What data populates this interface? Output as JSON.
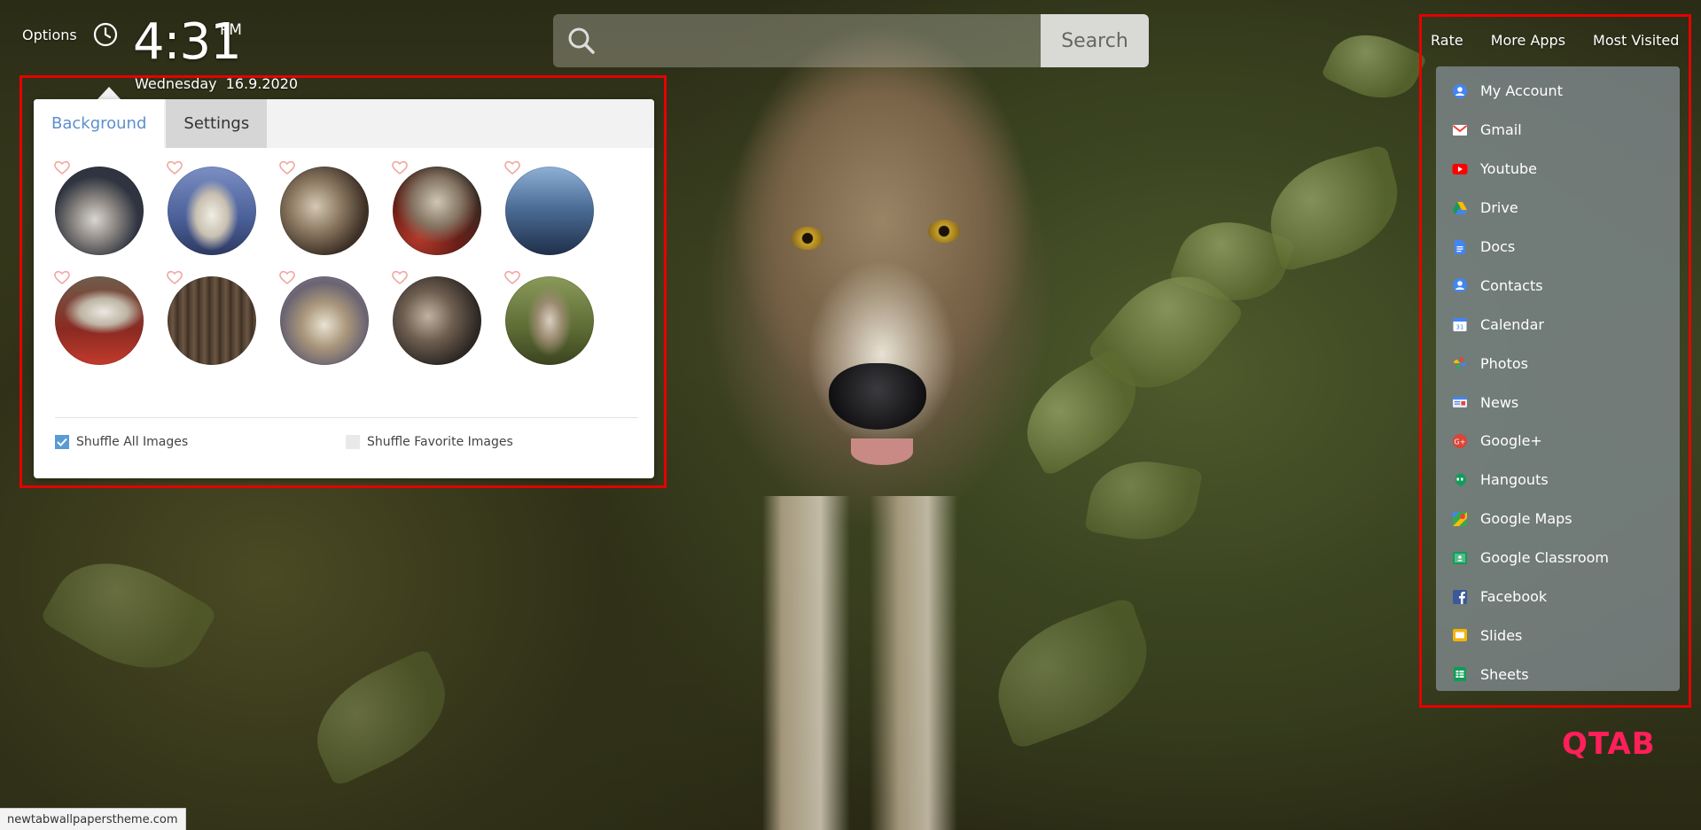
{
  "header": {
    "options_label": "Options",
    "time": "4:31",
    "ampm": "PM",
    "weekday": "Wednesday",
    "date": "16.9.2020"
  },
  "search": {
    "placeholder": "",
    "button_label": "Search"
  },
  "panel": {
    "tabs": [
      {
        "label": "Background",
        "active": true
      },
      {
        "label": "Settings",
        "active": false
      }
    ],
    "shuffle_all_label": "Shuffle All Images",
    "shuffle_all_checked": true,
    "shuffle_favorite_label": "Shuffle Favorite Images",
    "shuffle_favorite_checked": false
  },
  "top_nav": {
    "rate": "Rate",
    "more_apps": "More Apps",
    "most_visited": "Most Visited"
  },
  "apps": [
    {
      "label": "My Account",
      "icon": "account-icon",
      "color": "#4285f4"
    },
    {
      "label": "Gmail",
      "icon": "gmail-icon",
      "color": "#ea4335"
    },
    {
      "label": "Youtube",
      "icon": "youtube-icon",
      "color": "#ff0000"
    },
    {
      "label": "Drive",
      "icon": "drive-icon",
      "color": "#0f9d58"
    },
    {
      "label": "Docs",
      "icon": "docs-icon",
      "color": "#4285f4"
    },
    {
      "label": "Contacts",
      "icon": "contacts-icon",
      "color": "#4285f4"
    },
    {
      "label": "Calendar",
      "icon": "calendar-icon",
      "color": "#4285f4"
    },
    {
      "label": "Photos",
      "icon": "photos-icon",
      "color": "#fbbc05"
    },
    {
      "label": "News",
      "icon": "news-icon",
      "color": "#4285f4"
    },
    {
      "label": "Google+",
      "icon": "google-plus-icon",
      "color": "#db4437"
    },
    {
      "label": "Hangouts",
      "icon": "hangouts-icon",
      "color": "#0f9d58"
    },
    {
      "label": "Google Maps",
      "icon": "maps-icon",
      "color": "#34a853"
    },
    {
      "label": "Google Classroom",
      "icon": "classroom-icon",
      "color": "#0f9d58"
    },
    {
      "label": "Facebook",
      "icon": "facebook-icon",
      "color": "#3b5998"
    },
    {
      "label": "Slides",
      "icon": "slides-icon",
      "color": "#f4b400"
    },
    {
      "label": "Sheets",
      "icon": "sheets-icon",
      "color": "#0f9d58"
    }
  ],
  "brand": "QTAB",
  "status_url": "newtabwallpaperstheme.com",
  "colors": {
    "accent_blue": "#5b8fcf",
    "highlight_red": "#e60000",
    "brand_pink": "#ff1f5a"
  }
}
